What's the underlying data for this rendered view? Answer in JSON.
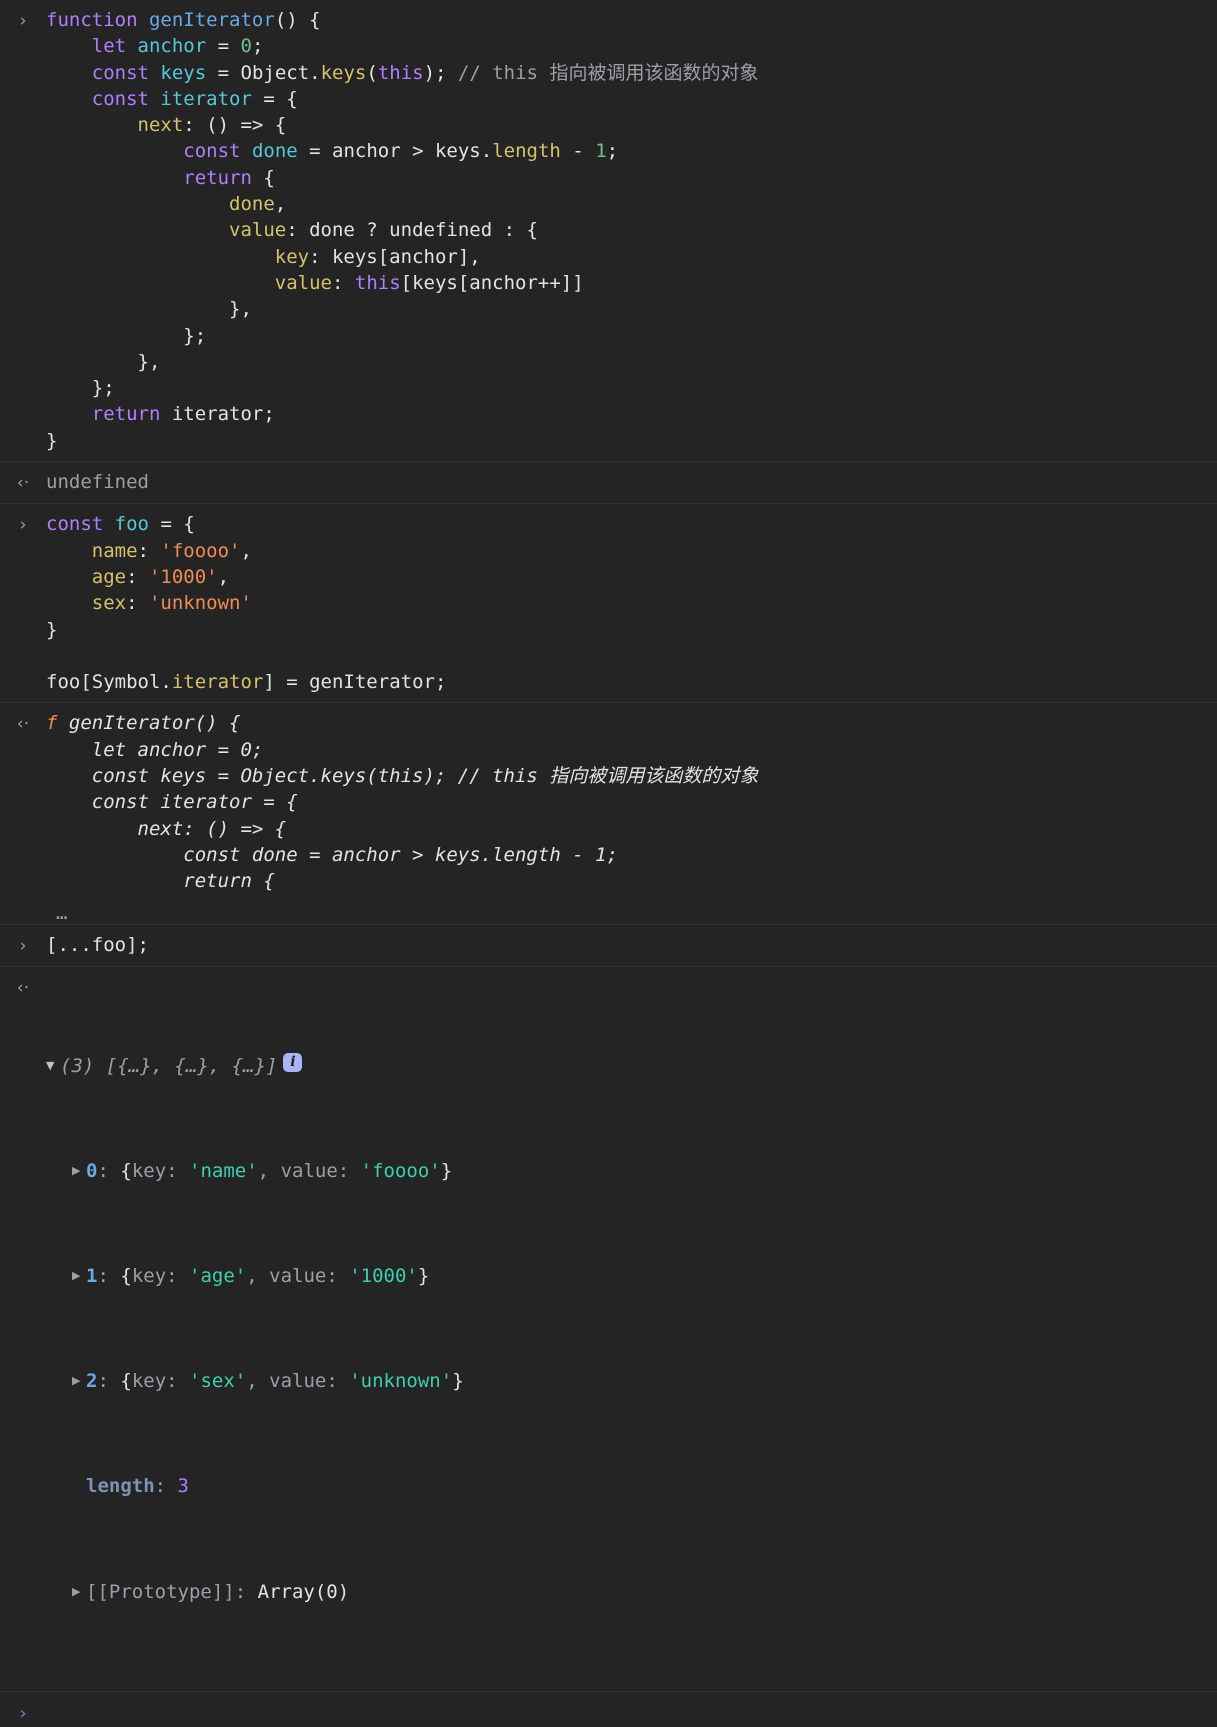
{
  "app": {
    "name": "Chrome DevTools Console",
    "theme": "dark",
    "background": "#242424",
    "accent": "#5a8dd6"
  },
  "icons": {
    "input_chevron": "›",
    "output_chevron": "‹·",
    "prompt_chevron": "›",
    "triangle_collapsed": "▶",
    "triangle_expanded": "▼",
    "info_badge": "i",
    "ellipsis": "…"
  },
  "entries": [
    {
      "id": "entry-1",
      "kind": "input",
      "code_lines": [
        "function genIterator() {",
        "    let anchor = 0;",
        "    const keys = Object.keys(this); // this 指向被调用该函数的对象",
        "    const iterator = {",
        "        next: () => {",
        "            const done = anchor > keys.length - 1;",
        "            return {",
        "                done,",
        "                value: done ? undefined : {",
        "                    key: keys[anchor],",
        "                    value: this[keys[anchor++]]",
        "                },",
        "            };",
        "        },",
        "    };",
        "    return iterator;",
        "}"
      ]
    },
    {
      "id": "entry-1-result",
      "kind": "output",
      "result_text": "undefined",
      "result_style": "undefined"
    },
    {
      "id": "entry-2",
      "kind": "input",
      "code_lines": [
        "const foo = {",
        "    name: 'foooo',",
        "    age: '1000',",
        "    sex: 'unknown'",
        "}",
        "",
        "foo[Symbol.iterator] = genIterator;"
      ]
    },
    {
      "id": "entry-2-result",
      "kind": "output",
      "result_kind": "function-preview",
      "function_marker": "f",
      "preview_lines": [
        "genIterator() {",
        "    let anchor = 0;",
        "    const keys = Object.keys(this); // this 指向被调用该函数的对象",
        "    const iterator = {",
        "        next: () => {",
        "            const done = anchor > keys.length - 1;",
        "            return {"
      ],
      "truncated_marker": "…"
    },
    {
      "id": "entry-3",
      "kind": "input",
      "code_lines": [
        "[...foo];"
      ]
    },
    {
      "id": "entry-3-result",
      "kind": "output",
      "result_kind": "array-inspector",
      "array_header": {
        "count": "(3)",
        "preview": "[{…}, {…}, {…}]",
        "expanded": true,
        "has_info_badge": true
      },
      "rows": [
        {
          "index": "0",
          "separator": ":",
          "open_brace": "{",
          "key_label": "key:",
          "key_value": "'name'",
          "comma": ",",
          "value_label": "value:",
          "value_value": "'foooo'",
          "close_brace": "}",
          "expandable": true
        },
        {
          "index": "1",
          "separator": ":",
          "open_brace": "{",
          "key_label": "key:",
          "key_value": "'age'",
          "comma": ",",
          "value_label": "value:",
          "value_value": "'1000'",
          "close_brace": "}",
          "expandable": true
        },
        {
          "index": "2",
          "separator": ":",
          "open_brace": "{",
          "key_label": "key:",
          "key_value": "'sex'",
          "comma": ",",
          "value_label": "value:",
          "value_value": "'unknown'",
          "close_brace": "}",
          "expandable": true
        }
      ],
      "length_row": {
        "label": "length",
        "separator": ":",
        "value": "3",
        "expandable": false
      },
      "prototype_row": {
        "label": "[[Prototype]]",
        "separator": ":",
        "value": "Array(0)",
        "expandable": true
      }
    }
  ],
  "prompt": {
    "value": "",
    "placeholder": ""
  },
  "colors": {
    "keyword": "#b07eff",
    "function_name": "#6aa8e8",
    "variable": "#56c8d8",
    "property": "#d6c26c",
    "number": "#6ec08d",
    "string": "#f28b54",
    "comment": "#9aa0a6",
    "plain": "#e3e3e3",
    "object_string": "#3ecfaf",
    "index": "#6aa8e8",
    "length_key": "#7b93b5",
    "length_value": "#b07eff",
    "info_badge_bg": "#a8b6f5"
  }
}
